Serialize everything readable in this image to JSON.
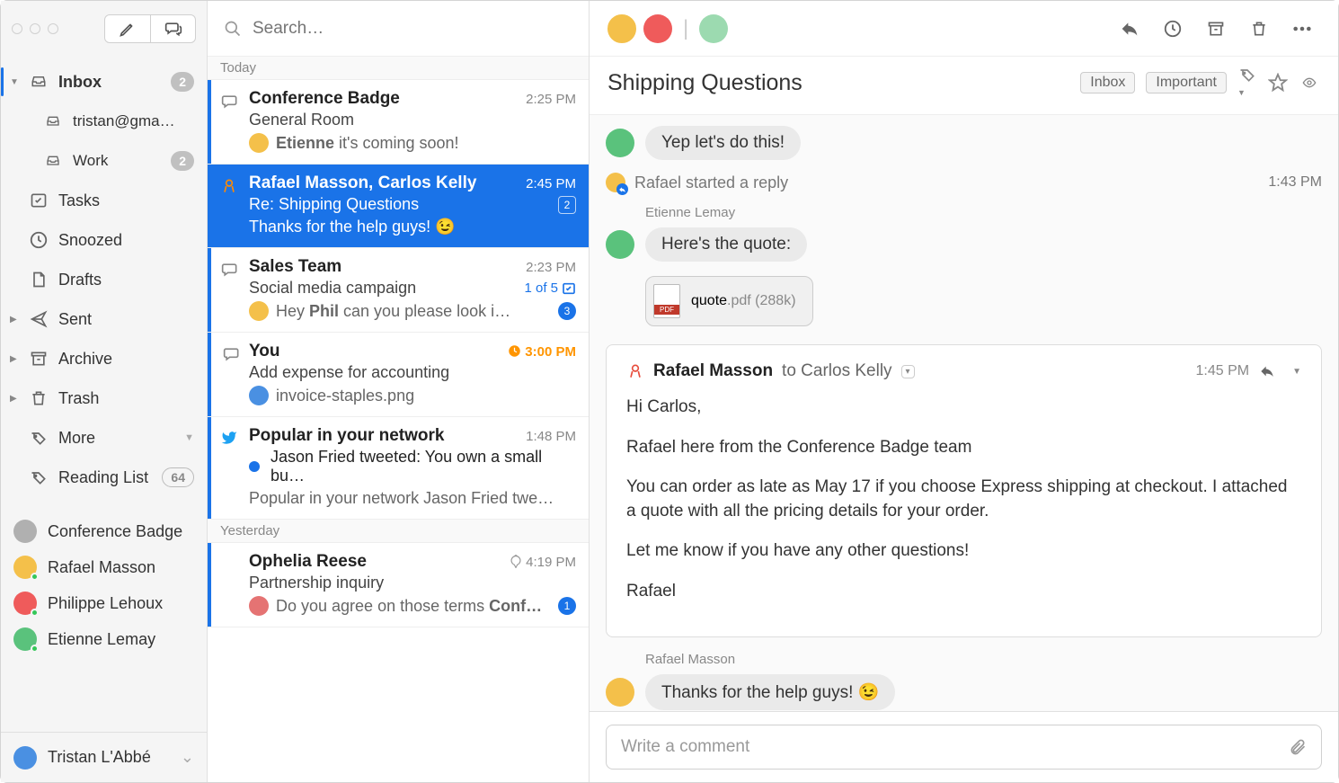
{
  "search_placeholder": "Search…",
  "sidebar": {
    "inbox": "Inbox",
    "inbox_badge": "2",
    "acct1": "tristan@gma…",
    "acct2": "Work",
    "acct2_badge": "2",
    "tasks": "Tasks",
    "snoozed": "Snoozed",
    "drafts": "Drafts",
    "sent": "Sent",
    "archive": "Archive",
    "trash": "Trash",
    "more": "More",
    "reading": "Reading List",
    "reading_badge": "64"
  },
  "contacts": [
    {
      "name": "Conference Badge",
      "color": "#b0b0b0"
    },
    {
      "name": "Rafael Masson",
      "color": "#f4c04a"
    },
    {
      "name": "Philippe Lehoux",
      "color": "#ef5b5b"
    },
    {
      "name": "Etienne Lemay",
      "color": "#5ac27c"
    }
  ],
  "user": "Tristan L'Abbé",
  "sections": {
    "today": "Today",
    "yesterday": "Yesterday"
  },
  "messages": [
    {
      "from": "Conference Badge",
      "time": "2:25 PM",
      "subj": "General Room",
      "prev": " it's coming soon!",
      "who": "Etienne",
      "av": "#f4c04a"
    },
    {
      "from": "Rafael Masson, Carlos Kelly",
      "time": "2:45 PM",
      "subj": "Re: Shipping Questions",
      "prev": "Thanks for the help guys!  😉",
      "badge": "2"
    },
    {
      "from": "Sales Team",
      "time": "2:23 PM",
      "subj": "Social media campaign",
      "meta": "1 of 5",
      "prev_prefix": "Hey ",
      "prev_bold": "Phil",
      "prev": " can you please look i…",
      "av": "#f4c04a",
      "count": "3"
    },
    {
      "from": "You",
      "time": "3:00 PM",
      "subj": "Add expense for accounting",
      "prev": "invoice-staples.png",
      "av": "#4a90e2",
      "orange": true
    },
    {
      "from": "Popular in your network",
      "time": "1:48 PM",
      "subj": "Jason Fried tweeted: You own a small bu…",
      "prev": "Popular in your network Jason Fried twe…",
      "twitter": true
    },
    {
      "from": "Ophelia Reese",
      "time": "4:19 PM",
      "subj": "Partnership inquiry",
      "prev": "Do you agree on those terms ",
      "prev_bold2": "Conf…",
      "av": "#e57373",
      "count": "1",
      "clip": true
    }
  ],
  "reader": {
    "title": "Shipping Questions",
    "tags": [
      "Inbox",
      "Important"
    ],
    "bubble1": "Yep let's do this!",
    "status": "Rafael started a reply",
    "status_time": "1:43 PM",
    "etienne": "Etienne Lemay",
    "quote_bubble": "Here's the quote:",
    "attach_name": "quote",
    "attach_ext": ".pdf (288k)",
    "card": {
      "from": "Rafael Masson",
      "to": "to Carlos Kelly",
      "time": "1:45 PM",
      "p1": "Hi Carlos,",
      "p2": "Rafael here from the Conference Badge team",
      "p3": "You can order as late as May 17 if you choose Express shipping at checkout. I attached a quote with all the pricing details for your order.",
      "p4": "Let me know if you have any other questions!",
      "p5": "Rafael"
    },
    "rafael": "Rafael Masson",
    "thanks": "Thanks for the help guys! 😉",
    "compose_placeholder": "Write a comment"
  }
}
